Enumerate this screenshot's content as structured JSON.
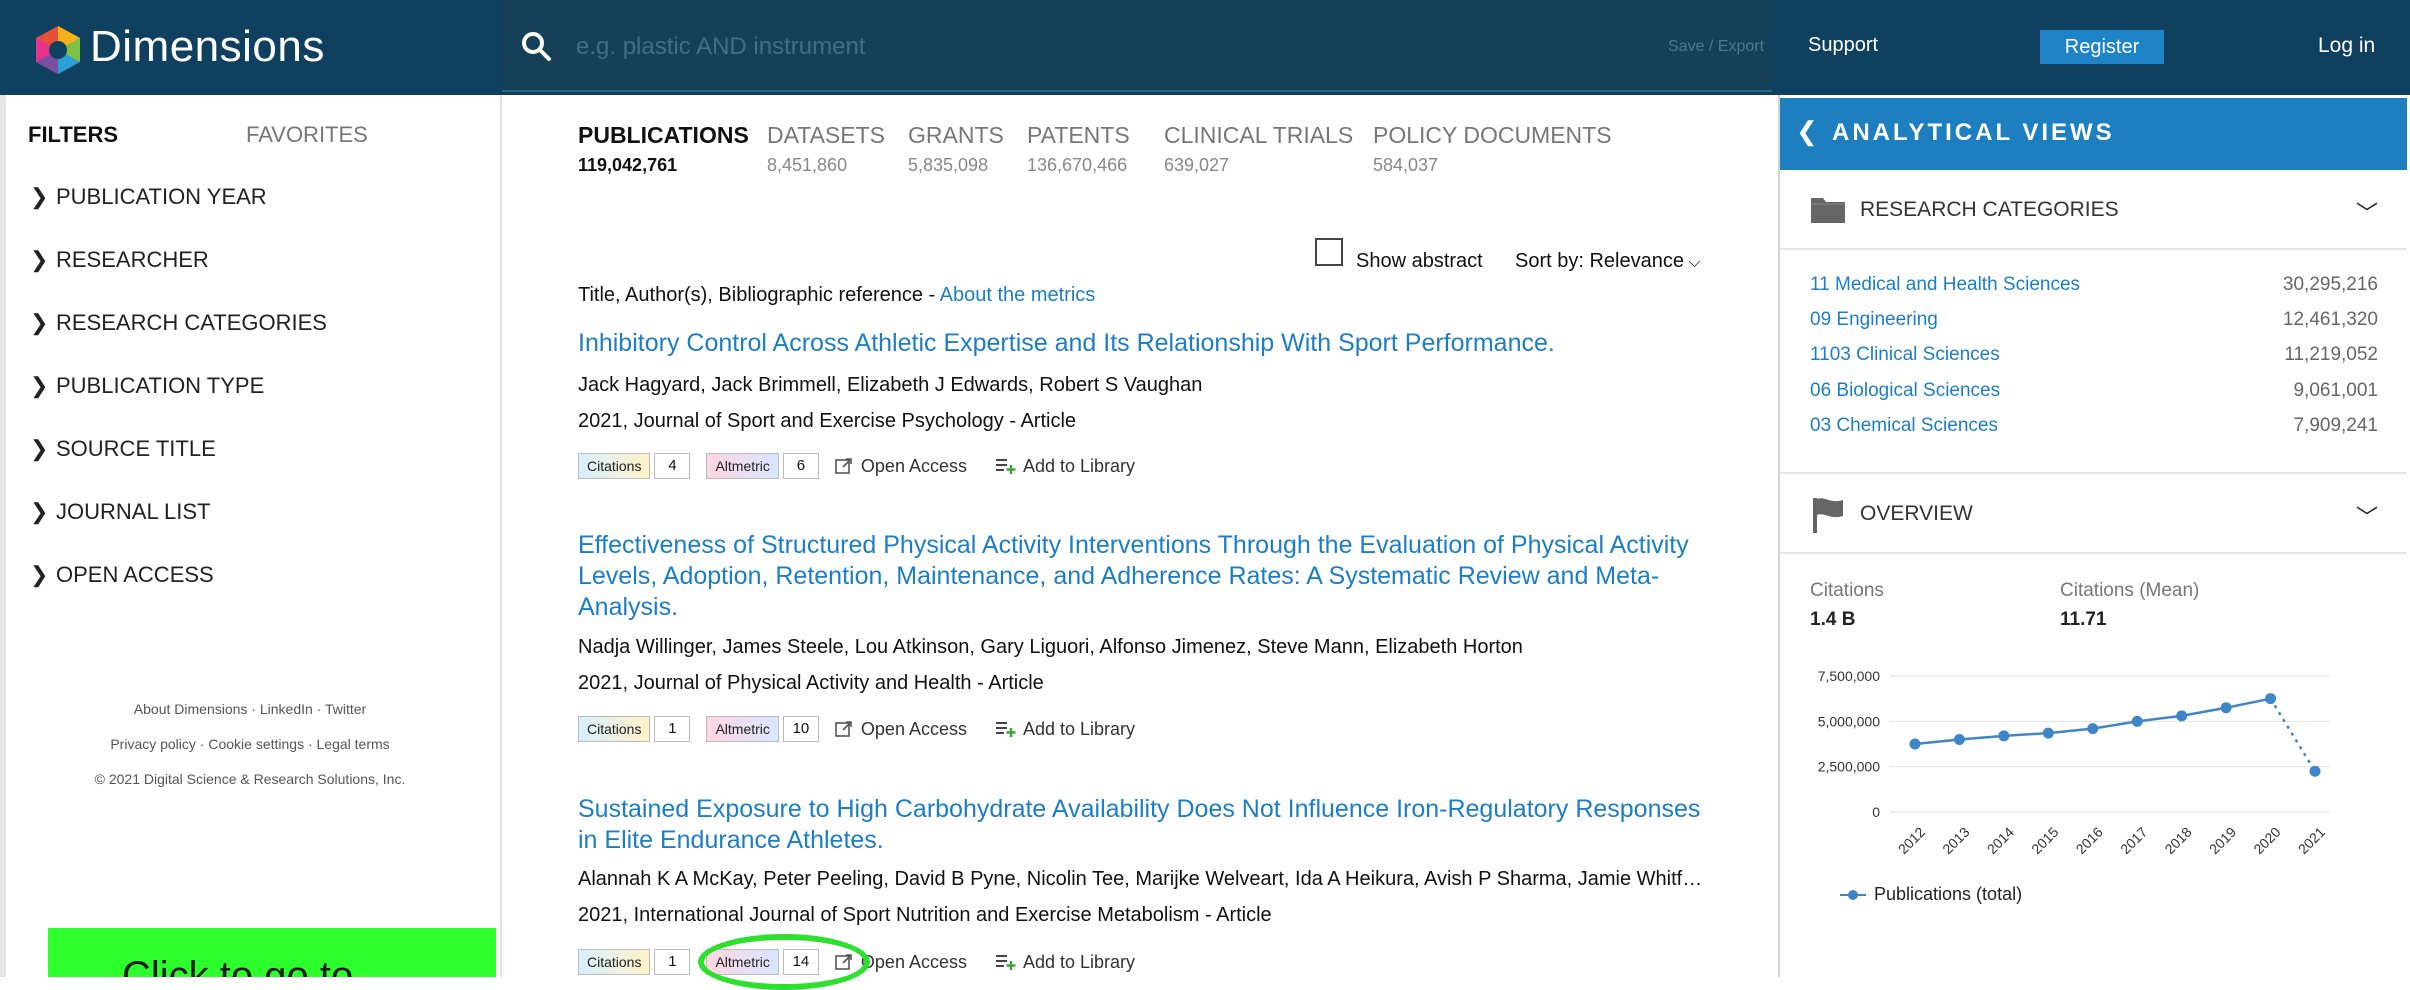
{
  "header": {
    "brand": "Dimensions",
    "search_placeholder": "e.g. plastic AND instrument",
    "save_export": "Save / Export",
    "support": "Support",
    "register": "Register",
    "login": "Log in"
  },
  "sidebar": {
    "tab_filters": "FILTERS",
    "tab_favorites": "FAVORITES",
    "filters": [
      "PUBLICATION YEAR",
      "RESEARCHER",
      "RESEARCH CATEGORIES",
      "PUBLICATION TYPE",
      "SOURCE TITLE",
      "JOURNAL LIST",
      "OPEN ACCESS"
    ],
    "footer": [
      "About Dimensions · LinkedIn · Twitter",
      "Privacy policy · Cookie settings · Legal terms",
      "© 2021 Digital Science & Research Solutions, Inc."
    ],
    "promo": "Click to go to"
  },
  "tabs": [
    {
      "label": "PUBLICATIONS",
      "count": "119,042,761"
    },
    {
      "label": "DATASETS",
      "count": "8,451,860"
    },
    {
      "label": "GRANTS",
      "count": "5,835,098"
    },
    {
      "label": "PATENTS",
      "count": "136,670,466"
    },
    {
      "label": "CLINICAL TRIALS",
      "count": "639,027"
    },
    {
      "label": "POLICY DOCUMENTS",
      "count": "584,037"
    }
  ],
  "results_toolbar": {
    "show_abstract": "Show abstract",
    "sort_by": "Sort by: Relevance",
    "column_header": "Title, Author(s), Bibliographic reference - ",
    "about_metrics": "About the metrics"
  },
  "publications": [
    {
      "title": "Inhibitory Control Across Athletic Expertise and Its Relationship With Sport Performance.",
      "authors": "Jack Hagyard, Jack Brimmell, Elizabeth J Edwards, Robert S Vaughan",
      "meta": "2021, Journal of Sport and Exercise Psychology - Article",
      "citations": "4",
      "altmetric": "6"
    },
    {
      "title": "Effectiveness of Structured Physical Activity Interventions Through the Evaluation of Physical Activity Levels, Adoption, Retention, Maintenance, and Adherence Rates: A Systematic Review and Meta-Analysis.",
      "authors": "Nadja Willinger, James Steele, Lou Atkinson, Gary Liguori, Alfonso Jimenez, Steve Mann, Elizabeth Horton",
      "meta": "2021, Journal of Physical Activity and Health - Article",
      "citations": "1",
      "altmetric": "10"
    },
    {
      "title": "Sustained Exposure to High Carbohydrate Availability Does Not Influence Iron-Regulatory Responses in Elite Endurance Athletes.",
      "authors": "Alannah K A McKay, Peter Peeling, David B Pyne, Nicolin Tee, Marijke Welveart, Ida A Heikura, Avish P Sharma, Jamie Whitfield…",
      "meta": "2021, International Journal of Sport Nutrition and Exercise Metabolism - Article",
      "citations": "1",
      "altmetric": "14"
    }
  ],
  "metric_labels": {
    "citations": "Citations",
    "altmetric": "Altmetric",
    "open_access": "Open Access",
    "add_library": "Add to Library"
  },
  "analytics": {
    "title": "ANALYTICAL VIEWS",
    "research_categories_title": "RESEARCH CATEGORIES",
    "categories": [
      {
        "name": "11 Medical and Health Sciences",
        "value": "30,295,216"
      },
      {
        "name": "09 Engineering",
        "value": "12,461,320"
      },
      {
        "name": "1103 Clinical Sciences",
        "value": "11,219,052"
      },
      {
        "name": "06 Biological Sciences",
        "value": "9,061,001"
      },
      {
        "name": "03 Chemical Sciences",
        "value": "7,909,241"
      }
    ],
    "overview_title": "OVERVIEW",
    "citations_label": "Citations",
    "citations_value": "1.4 B",
    "citations_mean_label": "Citations (Mean)",
    "citations_mean_value": "11.71"
  },
  "chart_data": {
    "type": "line",
    "x": [
      "2012",
      "2013",
      "2014",
      "2015",
      "2016",
      "2017",
      "2018",
      "2019",
      "2020",
      "2021"
    ],
    "series": [
      {
        "name": "Publications (total)",
        "values": [
          3750000,
          4000000,
          4200000,
          4350000,
          4600000,
          5000000,
          5300000,
          5750000,
          6250000,
          2250000
        ]
      }
    ],
    "yticks": [
      "0",
      "2,500,000",
      "5,000,000",
      "7,500,000"
    ],
    "ylim": [
      0,
      7500000
    ],
    "last_segment_dotted": true,
    "grid": true,
    "legend": "bottom-left",
    "color": "#3f86c8"
  }
}
